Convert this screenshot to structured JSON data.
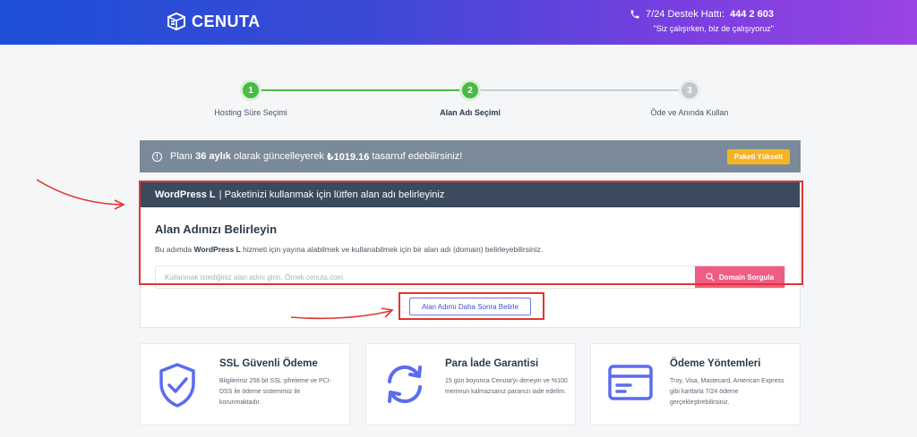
{
  "header": {
    "brand": "CENUTA",
    "support_label": "7/24 Destek Hattı:",
    "support_number": "444 2 603",
    "support_tagline": "\"Siz çalışırken, biz de çalışıyoruz\""
  },
  "stepper": {
    "steps": [
      {
        "number": "1",
        "label": "Hosting Süre Seçimi",
        "status": "done"
      },
      {
        "number": "2",
        "label": "Alan Adı Seçimi",
        "status": "active"
      },
      {
        "number": "3",
        "label": "Öde ve Anında Kullan",
        "status": "pending"
      }
    ]
  },
  "promo": {
    "prefix": "Planı",
    "duration": "36 aylık",
    "middle": "olarak güncelleyerek",
    "amount": "₺1019.16",
    "suffix": "tasarruf edebilirsiniz!",
    "button_label": "Paketi Yükselt"
  },
  "domain": {
    "header_package": "WordPress L",
    "header_text": "| Paketinizi kullanmak için lütfen alan adı belirleyiniz",
    "title": "Alan Adınızı Belirleyin",
    "desc_prefix": "Bu adımda",
    "desc_package": "WordPress L",
    "desc_suffix": "hizmeti için yayına alabilmek ve kullanabilmek için bir alan adı (domain) belirleyebilirsiniz.",
    "input_placeholder": "Kullanmak istediğiniz alan adını girin. Örnek cenuta.com",
    "input_value": "",
    "search_button": "Domain Sorgula",
    "later_button": "Alan Adımı Daha Sonra Belirle"
  },
  "features": [
    {
      "icon": "shield-check-icon",
      "title": "SSL Güvenli Ödeme",
      "text": "Bilgileriniz 256 bit SSL şifreleme ve PCI-DSS ile ödeme sistemimiz ile korunmaktadır."
    },
    {
      "icon": "refresh-icon",
      "title": "Para İade Garantisi",
      "text": "15 gün boyunca Cenuta'yı deneyin ve %100 memnun kalmazsanız paranızı iade edelim."
    },
    {
      "icon": "credit-card-icon",
      "title": "Ödeme Yöntemleri",
      "text": "Troy, Visa, Mastecard, American Express gibi kartlarla 7/24 ödeme gerçekleştirebilirsiniz."
    }
  ],
  "colors": {
    "accent": "#5b6cf0",
    "success": "#4cb848",
    "pink": "#ef5d85",
    "highlight": "#e3342f"
  }
}
